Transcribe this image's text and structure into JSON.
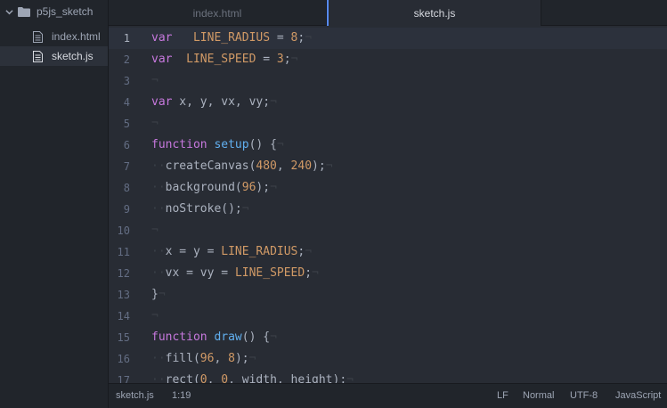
{
  "tree": {
    "project": "p5js_sketch",
    "files": [
      "index.html",
      "sketch.js"
    ]
  },
  "tabs": [
    {
      "label": "index.html",
      "active": false
    },
    {
      "label": "sketch.js",
      "active": true
    }
  ],
  "editor": {
    "active_line": 1,
    "lines": [
      {
        "n": "1",
        "t": [
          [
            "kw",
            "var"
          ],
          [
            "",
            "   "
          ],
          [
            "con",
            "LINE_RADIUS"
          ],
          [
            "",
            " = "
          ],
          [
            "num",
            "8"
          ],
          [
            "",
            ";"
          ],
          [
            "inv",
            "¬"
          ]
        ]
      },
      {
        "n": "2",
        "t": [
          [
            "kw",
            "var"
          ],
          [
            "",
            "  "
          ],
          [
            "con",
            "LINE_SPEED"
          ],
          [
            "",
            " = "
          ],
          [
            "num",
            "3"
          ],
          [
            "",
            ";"
          ],
          [
            "inv",
            "¬"
          ]
        ]
      },
      {
        "n": "3",
        "t": [
          [
            "inv",
            "¬"
          ]
        ]
      },
      {
        "n": "4",
        "t": [
          [
            "kw",
            "var"
          ],
          [
            "",
            " x, y, vx, vy;"
          ],
          [
            "inv",
            "¬"
          ]
        ]
      },
      {
        "n": "5",
        "t": [
          [
            "inv",
            "¬"
          ]
        ]
      },
      {
        "n": "6",
        "t": [
          [
            "kw",
            "function"
          ],
          [
            "",
            " "
          ],
          [
            "fn",
            "setup"
          ],
          [
            "",
            "() {"
          ],
          [
            "inv",
            "¬"
          ]
        ]
      },
      {
        "n": "7",
        "t": [
          [
            "inv",
            "··"
          ],
          [
            "",
            "createCanvas("
          ],
          [
            "num",
            "480"
          ],
          [
            "",
            ", "
          ],
          [
            "num",
            "240"
          ],
          [
            "",
            ");"
          ],
          [
            "inv",
            "¬"
          ]
        ]
      },
      {
        "n": "8",
        "t": [
          [
            "inv",
            "··"
          ],
          [
            "",
            "background("
          ],
          [
            "num",
            "96"
          ],
          [
            "",
            ");"
          ],
          [
            "inv",
            "¬"
          ]
        ]
      },
      {
        "n": "9",
        "t": [
          [
            "inv",
            "··"
          ],
          [
            "",
            "noStroke();"
          ],
          [
            "inv",
            "¬"
          ]
        ]
      },
      {
        "n": "10",
        "t": [
          [
            "inv",
            "¬"
          ]
        ]
      },
      {
        "n": "11",
        "t": [
          [
            "inv",
            "··"
          ],
          [
            "",
            "x = y = "
          ],
          [
            "con",
            "LINE_RADIUS"
          ],
          [
            "",
            ";"
          ],
          [
            "inv",
            "¬"
          ]
        ]
      },
      {
        "n": "12",
        "t": [
          [
            "inv",
            "··"
          ],
          [
            "",
            "vx = vy = "
          ],
          [
            "con",
            "LINE_SPEED"
          ],
          [
            "",
            ";"
          ],
          [
            "inv",
            "¬"
          ]
        ]
      },
      {
        "n": "13",
        "t": [
          [
            "",
            "}"
          ],
          [
            "inv",
            "¬"
          ]
        ]
      },
      {
        "n": "14",
        "t": [
          [
            "inv",
            "¬"
          ]
        ]
      },
      {
        "n": "15",
        "t": [
          [
            "kw",
            "function"
          ],
          [
            "",
            " "
          ],
          [
            "fn",
            "draw"
          ],
          [
            "",
            "() {"
          ],
          [
            "inv",
            "¬"
          ]
        ]
      },
      {
        "n": "16",
        "t": [
          [
            "inv",
            "··"
          ],
          [
            "",
            "fill("
          ],
          [
            "num",
            "96"
          ],
          [
            "",
            ", "
          ],
          [
            "num",
            "8"
          ],
          [
            "",
            ");"
          ],
          [
            "inv",
            "¬"
          ]
        ]
      },
      {
        "n": "17",
        "t": [
          [
            "inv",
            "··"
          ],
          [
            "",
            "rect("
          ],
          [
            "num",
            "0"
          ],
          [
            "",
            ", "
          ],
          [
            "num",
            "0"
          ],
          [
            "",
            ", width, height);"
          ],
          [
            "inv",
            "¬"
          ]
        ]
      }
    ]
  },
  "status": {
    "file": "sketch.js",
    "cursor": "1:19",
    "line_ending": "LF",
    "mode": "Normal",
    "encoding": "UTF-8",
    "grammar": "JavaScript"
  },
  "colors": {
    "background": "#282c34",
    "sidebar": "#21252b",
    "accent": "#568af2",
    "keyword": "#c678dd",
    "constant": "#d19a66",
    "function": "#61afef"
  }
}
